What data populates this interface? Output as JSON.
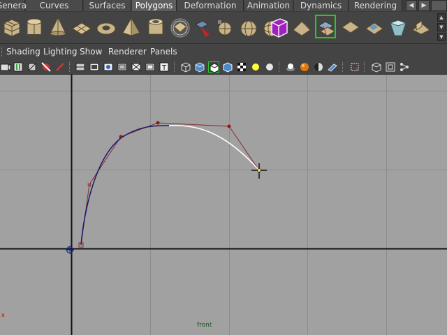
{
  "shelf_tabs": {
    "items": [
      {
        "label": "General"
      },
      {
        "label": "Curves"
      },
      {
        "label": "Surfaces"
      },
      {
        "label": "Polygons",
        "active": true
      },
      {
        "label": "Deformation"
      },
      {
        "label": "Animation"
      },
      {
        "label": "Dynamics"
      },
      {
        "label": "Rendering"
      }
    ],
    "nav_left": "◀",
    "nav_right": "▶"
  },
  "shelf_icons": [
    "poly-cube-icon",
    "poly-cylinder-icon",
    "poly-cone-icon",
    "poly-plane-icon",
    "poly-torus-icon",
    "poly-pyramid-icon",
    "poly-pipe-icon",
    "poly-soccer-ball-icon",
    "poly-helix-icon",
    "poly-extrude-icon",
    "poly-sphere-icon",
    "poly-sphere-mesh-icon",
    "poly-purple-cube-icon",
    "poly-wedge-icon",
    "poly-bevel-icon",
    "poly-selection-icon",
    "poly-split-icon",
    "poly-merge-icon",
    "poly-append-icon",
    "poly-smooth-icon"
  ],
  "panel_menu": {
    "items": [
      "Shading",
      "Lighting",
      "Show",
      "Renderer",
      "Panels"
    ]
  },
  "panel_toolbar_icons": [
    "camera-select-icon",
    "camera-attributes-icon",
    "bookmark-icon",
    "image-plane-icon",
    "grid-icon",
    "film-gate-icon",
    "resolution-gate-icon",
    "gate-mask-icon",
    "field-chart-icon",
    "safe-action-icon",
    "safe-title-icon",
    "wireframe-icon",
    "smooth-shade-icon",
    "wireframe-on-shaded-icon",
    "textured-icon",
    "use-default-light-icon",
    "shadows-icon",
    "xray-icon",
    "xray-joints-icon",
    "xray-components-icon",
    "isolate-select-icon",
    "frame-selected-icon",
    "frame-all-icon"
  ],
  "viewport": {
    "camera_name": "front",
    "axis_label": "x",
    "background_color": "#a1a1a1",
    "grid_color": "#8a8a8a",
    "axis_color": "#111111",
    "curve_built_color": "#1a1a70",
    "curve_pending_color": "#ffffff",
    "hull_color": "#8a2a2a",
    "cv_first_label": "u"
  }
}
